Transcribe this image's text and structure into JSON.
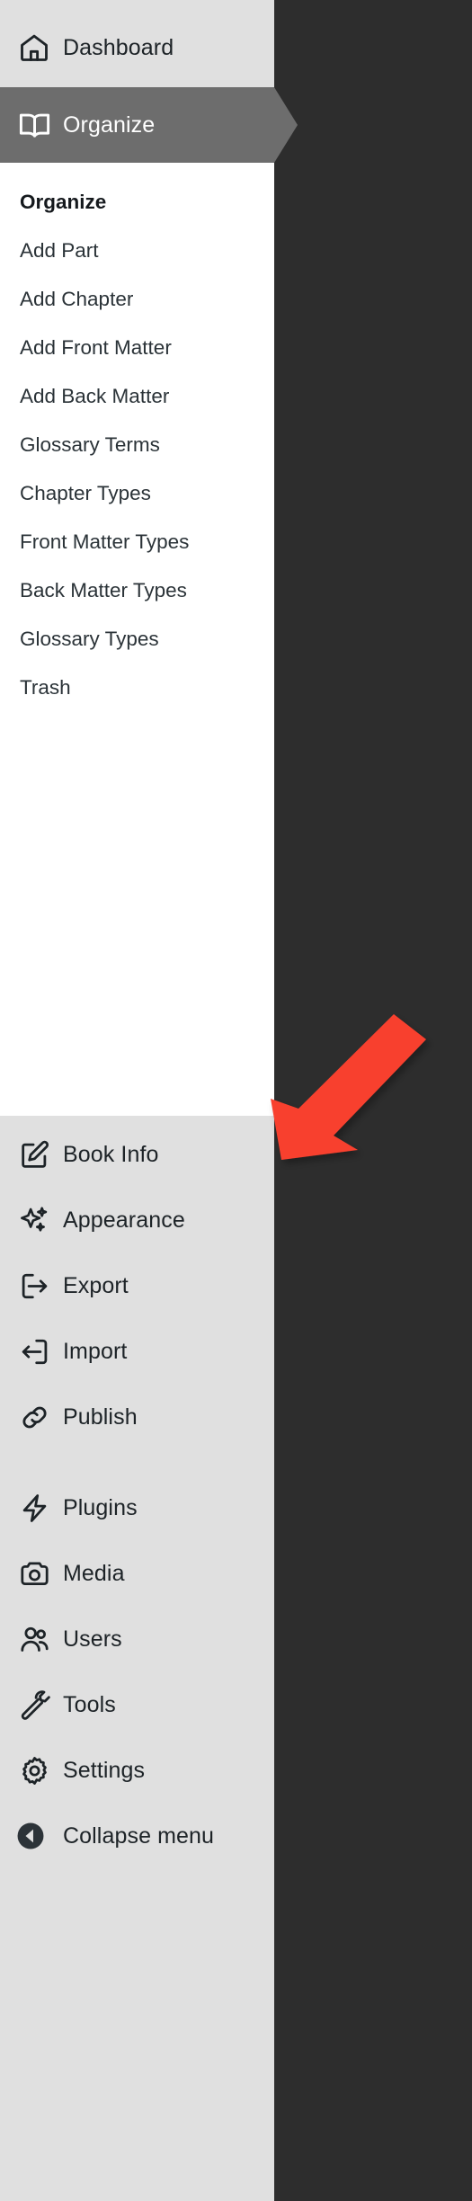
{
  "app": {
    "sidebar_bg": "#e0e0e0",
    "submenu_bg": "#ffffff",
    "current_item_bg": "#6d6d6d",
    "text_color": "#1d2327",
    "annotation_color": "#f8402f"
  },
  "sidebar": {
    "top_items": [
      {
        "label": "Dashboard",
        "icon": "home-icon",
        "state": "normal"
      },
      {
        "label": "Organize",
        "icon": "open-book-icon",
        "state": "current"
      }
    ],
    "submenu": {
      "parent": "Organize",
      "items": [
        {
          "label": "Organize",
          "current": true
        },
        {
          "label": "Add Part",
          "current": false
        },
        {
          "label": "Add Chapter",
          "current": false
        },
        {
          "label": "Add Front Matter",
          "current": false
        },
        {
          "label": "Add Back Matter",
          "current": false
        },
        {
          "label": "Glossary Terms",
          "current": false
        },
        {
          "label": "Chapter Types",
          "current": false
        },
        {
          "label": "Front Matter Types",
          "current": false
        },
        {
          "label": "Back Matter Types",
          "current": false
        },
        {
          "label": "Glossary Types",
          "current": false
        },
        {
          "label": "Trash",
          "current": false
        }
      ]
    },
    "lower_items": [
      {
        "label": "Book Info",
        "icon": "edit-square-icon"
      },
      {
        "label": "Appearance",
        "icon": "sparkles-icon"
      },
      {
        "label": "Export",
        "icon": "export-arrow-icon"
      },
      {
        "label": "Import",
        "icon": "import-arrow-icon"
      },
      {
        "label": "Publish",
        "icon": "link-chain-icon"
      },
      {
        "label": "Plugins",
        "icon": "lightning-bolt-icon"
      },
      {
        "label": "Media",
        "icon": "camera-icon"
      },
      {
        "label": "Users",
        "icon": "users-icon"
      },
      {
        "label": "Tools",
        "icon": "wrench-icon"
      },
      {
        "label": "Settings",
        "icon": "gear-icon"
      },
      {
        "label": "Collapse menu",
        "icon": "collapse-left-icon"
      }
    ]
  },
  "annotation": {
    "type": "arrow",
    "points_at": "Book Info",
    "color": "#f8402f"
  }
}
